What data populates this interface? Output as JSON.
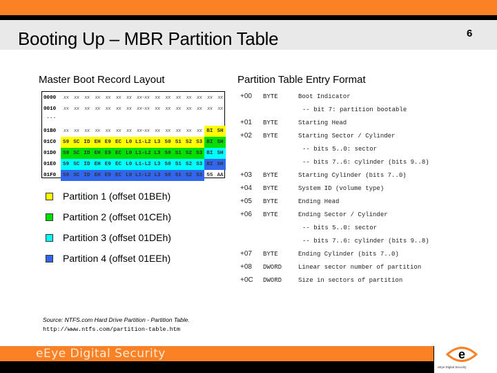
{
  "slide": {
    "title": "Booting Up – MBR Partition Table",
    "number": "6"
  },
  "colors": {
    "orange": "#fb8125",
    "partition1": "#ffff00",
    "partition2": "#00e000",
    "partition3": "#00ffff",
    "partition4": "#3366ee"
  },
  "mbr": {
    "heading": "Master Boot Record Layout",
    "ellipsis": "...",
    "rows": [
      {
        "addr": "0000",
        "cells": [
          "xx",
          "xx",
          "xx",
          "xx",
          "xx",
          "xx",
          "xx",
          "xx-xx",
          "xx",
          "xx",
          "xx",
          "xx",
          "xx",
          "xx",
          "xx"
        ],
        "colors": [
          "",
          "",
          "",
          "",
          "",
          "",
          "",
          "",
          "",
          "",
          "",
          "",
          "",
          "",
          ""
        ]
      },
      {
        "addr": "0010",
        "cells": [
          "xx",
          "xx",
          "xx",
          "xx",
          "xx",
          "xx",
          "xx",
          "xx-xx",
          "xx",
          "xx",
          "xx",
          "xx",
          "xx",
          "xx",
          "xx"
        ],
        "colors": [
          "",
          "",
          "",
          "",
          "",
          "",
          "",
          "",
          "",
          "",
          "",
          "",
          "",
          "",
          ""
        ]
      },
      {
        "addr": "01B0",
        "cells": [
          "xx",
          "xx",
          "xx",
          "xx",
          "xx",
          "xx",
          "xx",
          "xx-xx",
          "xx",
          "xx",
          "xx",
          "xx",
          "xx",
          "BI",
          "SH"
        ],
        "colors": [
          "",
          "",
          "",
          "",
          "",
          "",
          "",
          "",
          "",
          "",
          "",
          "",
          "",
          "p1",
          "p1"
        ]
      },
      {
        "addr": "01C0",
        "cells": [
          "S9",
          "SC",
          "ID",
          "EH",
          "E9",
          "EC",
          "L0",
          "L1-L2",
          "L3",
          "S0",
          "S1",
          "S2",
          "S3",
          "BI",
          "SH"
        ],
        "colors": [
          "p1",
          "p1",
          "p1",
          "p1",
          "p1",
          "p1",
          "p1",
          "p1",
          "p1",
          "p1",
          "p1",
          "p1",
          "p1",
          "p2",
          "p2"
        ]
      },
      {
        "addr": "01D0",
        "cells": [
          "S9",
          "SC",
          "ID",
          "EH",
          "E9",
          "EC",
          "L0",
          "L1-L2",
          "L3",
          "S0",
          "S1",
          "S2",
          "S3",
          "BI",
          "SH"
        ],
        "colors": [
          "p2",
          "p2",
          "p2",
          "p2",
          "p2",
          "p2",
          "p2",
          "p2",
          "p2",
          "p2",
          "p2",
          "p2",
          "p2",
          "p3",
          "p3"
        ]
      },
      {
        "addr": "01E0",
        "cells": [
          "S9",
          "SC",
          "ID",
          "EH",
          "E9",
          "EC",
          "L0",
          "L1-L2",
          "L3",
          "S0",
          "S1",
          "S2",
          "S3",
          "BI",
          "SH"
        ],
        "colors": [
          "p3",
          "p3",
          "p3",
          "p3",
          "p3",
          "p3",
          "p3",
          "p3",
          "p3",
          "p3",
          "p3",
          "p3",
          "p3",
          "p4",
          "p4"
        ]
      },
      {
        "addr": "01F0",
        "cells": [
          "S9",
          "SC",
          "ID",
          "EH",
          "E9",
          "EC",
          "L0",
          "L1-L2",
          "L3",
          "S0",
          "S1",
          "S2",
          "S3",
          "55",
          "AA"
        ],
        "colors": [
          "p4",
          "p4",
          "p4",
          "p4",
          "p4",
          "p4",
          "p4",
          "p4",
          "p4",
          "p4",
          "p4",
          "p4",
          "p4",
          "",
          ""
        ]
      }
    ]
  },
  "legend": [
    {
      "label": "Partition 1 (offset 01BEh)",
      "color": "p1"
    },
    {
      "label": "Partition 2 (offset 01CEh)",
      "color": "p2"
    },
    {
      "label": "Partition 3 (offset 01DEh)",
      "color": "p3"
    },
    {
      "label": "Partition 4 (offset 01EEh)",
      "color": "p4"
    }
  ],
  "format": {
    "heading": "Partition Table Entry Format",
    "lines": [
      {
        "offset": "+00",
        "type": "BYTE",
        "desc": "Boot Indicator"
      },
      {
        "note": "-- bit 7: partition bootable"
      },
      {
        "offset": "+01",
        "type": "BYTE",
        "desc": "Starting Head"
      },
      {
        "offset": "+02",
        "type": "BYTE",
        "desc": "Starting Sector / Cylinder"
      },
      {
        "note": "-- bits 5..0: sector"
      },
      {
        "note": "-- bits 7..6: cylinder (bits 9..8)"
      },
      {
        "offset": "+03",
        "type": "BYTE",
        "desc": "Starting Cylinder (bits 7..0)"
      },
      {
        "offset": "+04",
        "type": "BYTE",
        "desc": "System ID (volume type)"
      },
      {
        "offset": "+05",
        "type": "BYTE",
        "desc": "Ending Head"
      },
      {
        "offset": "+06",
        "type": "BYTE",
        "desc": "Ending Sector / Cylinder"
      },
      {
        "note": "-- bits 5..0: sector"
      },
      {
        "note": "-- bits 7..6: cylinder (bits 9..8)"
      },
      {
        "offset": "+07",
        "type": "BYTE",
        "desc": "Ending Cylinder (bits 7..0)"
      },
      {
        "offset": "+08",
        "type": "DWORD",
        "desc": "Linear sector number of partition"
      },
      {
        "offset": "+0C",
        "type": "DWORD",
        "desc": "Size in sectors of partition"
      }
    ]
  },
  "source": {
    "text": "Source: NTFS.com Hard Drive Partition - Partition Table.",
    "url": "http://www.ntfs.com/partition-table.htm"
  },
  "footer": {
    "brand": "eEye Digital Security",
    "logo_letter": "e",
    "logo_caption": "eEye Digital Security"
  }
}
